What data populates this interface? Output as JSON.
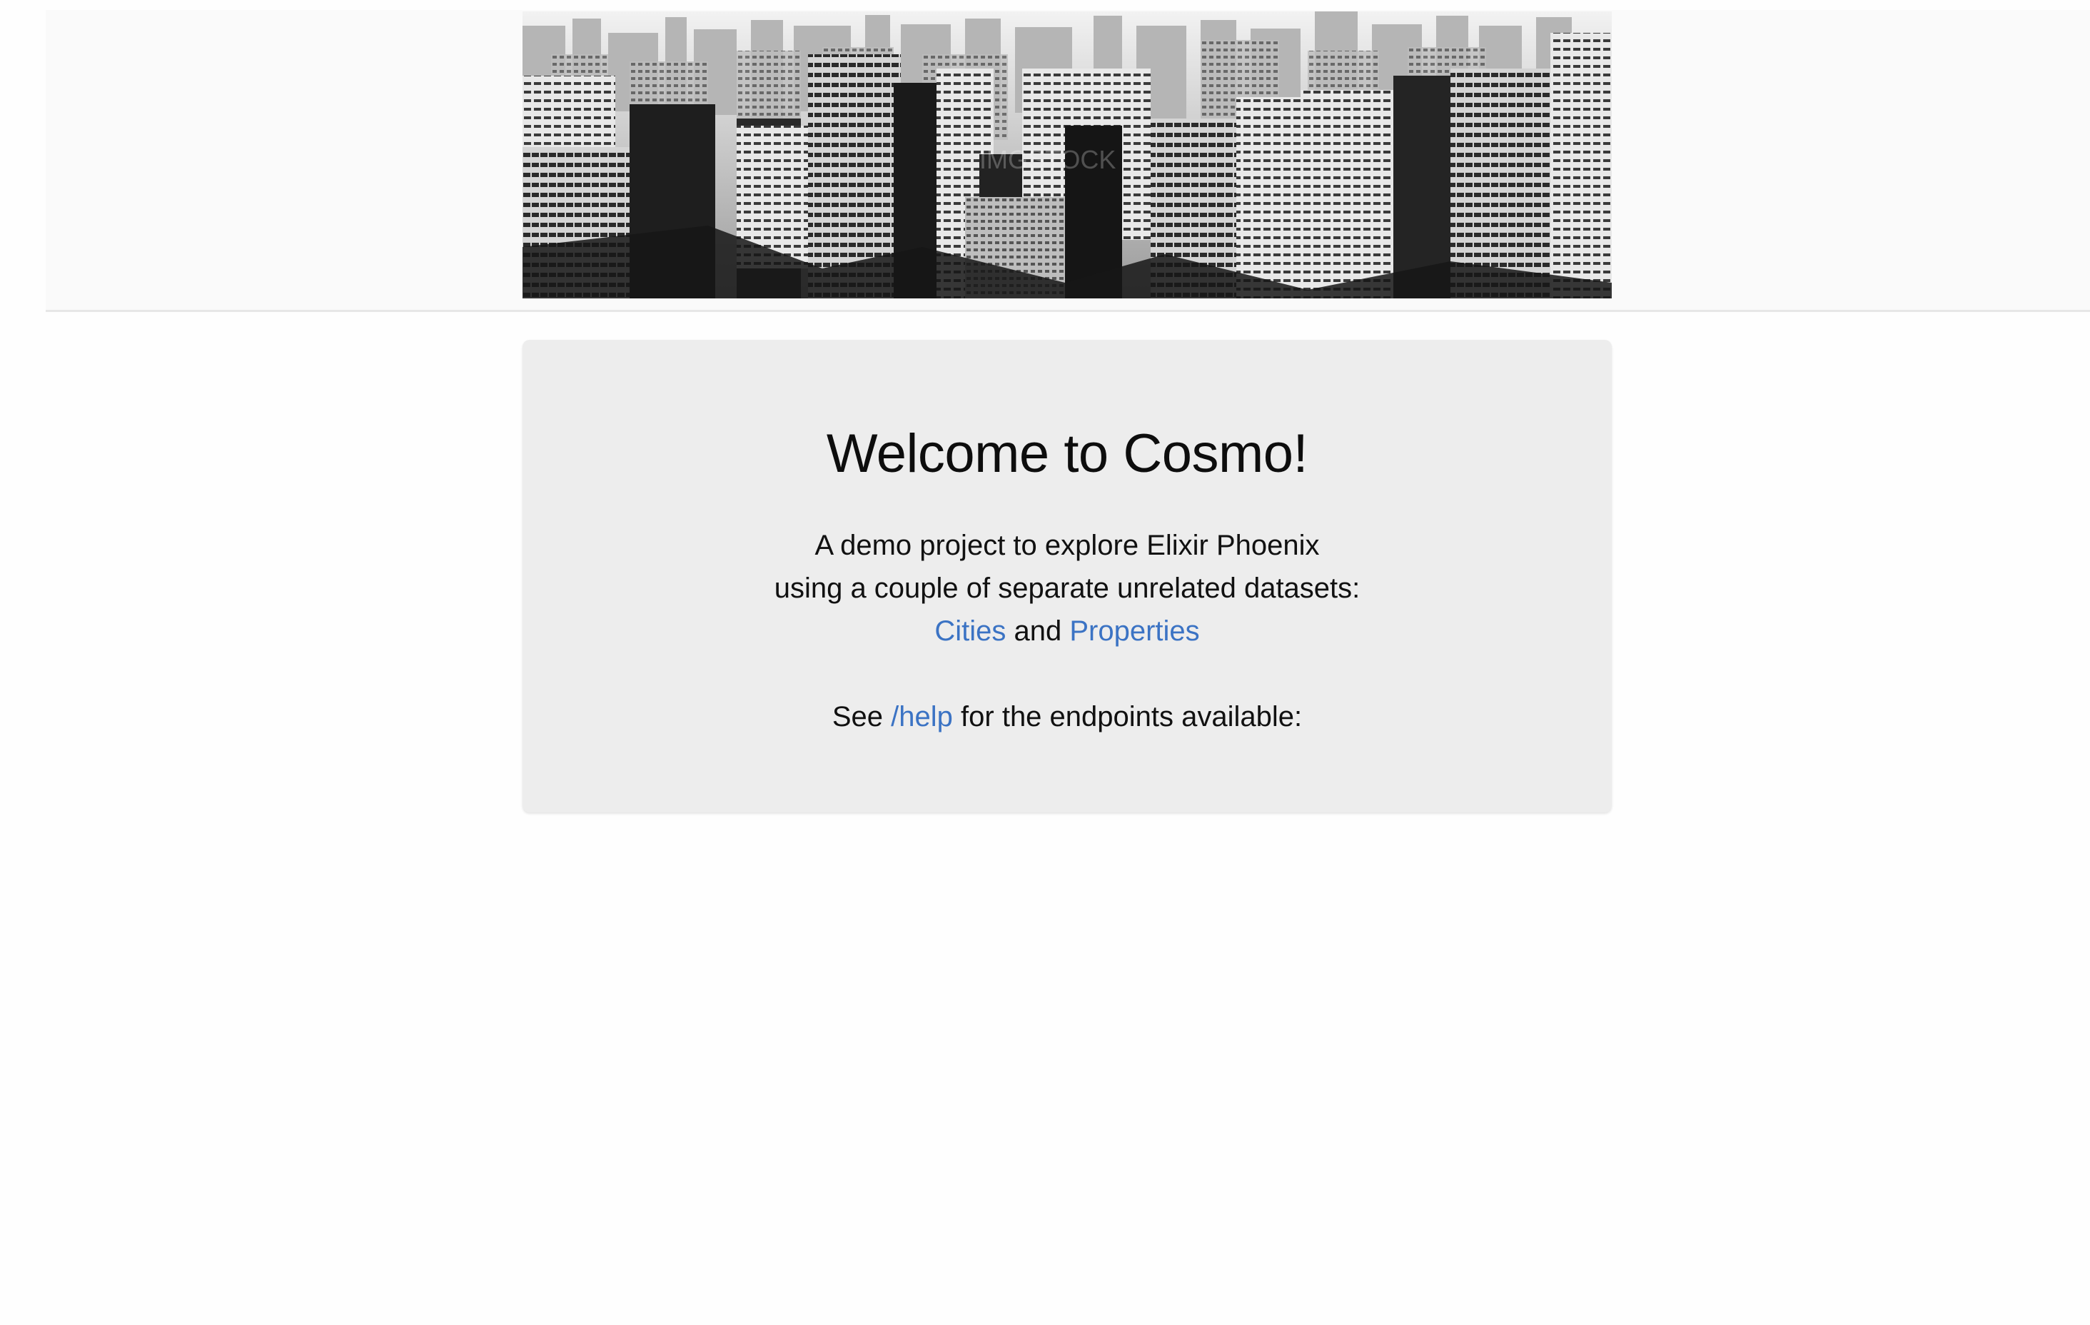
{
  "banner": {
    "alt": "City skyline",
    "watermark": "IMGSTOCK"
  },
  "jumbotron": {
    "title": "Welcome to Cosmo!",
    "lines": [
      "A demo project to explore Elixir Phoenix",
      "using a couple of separate unrelated datasets:"
    ],
    "links": {
      "cities": "Cities",
      "conjunction": "and",
      "properties": "Properties"
    },
    "help": {
      "prefix": "See",
      "link": "/help",
      "suffix": "for the endpoints available:"
    }
  },
  "colors": {
    "link": "#3b73c4",
    "panel": "#ededed",
    "header_bg": "#fafafa"
  }
}
